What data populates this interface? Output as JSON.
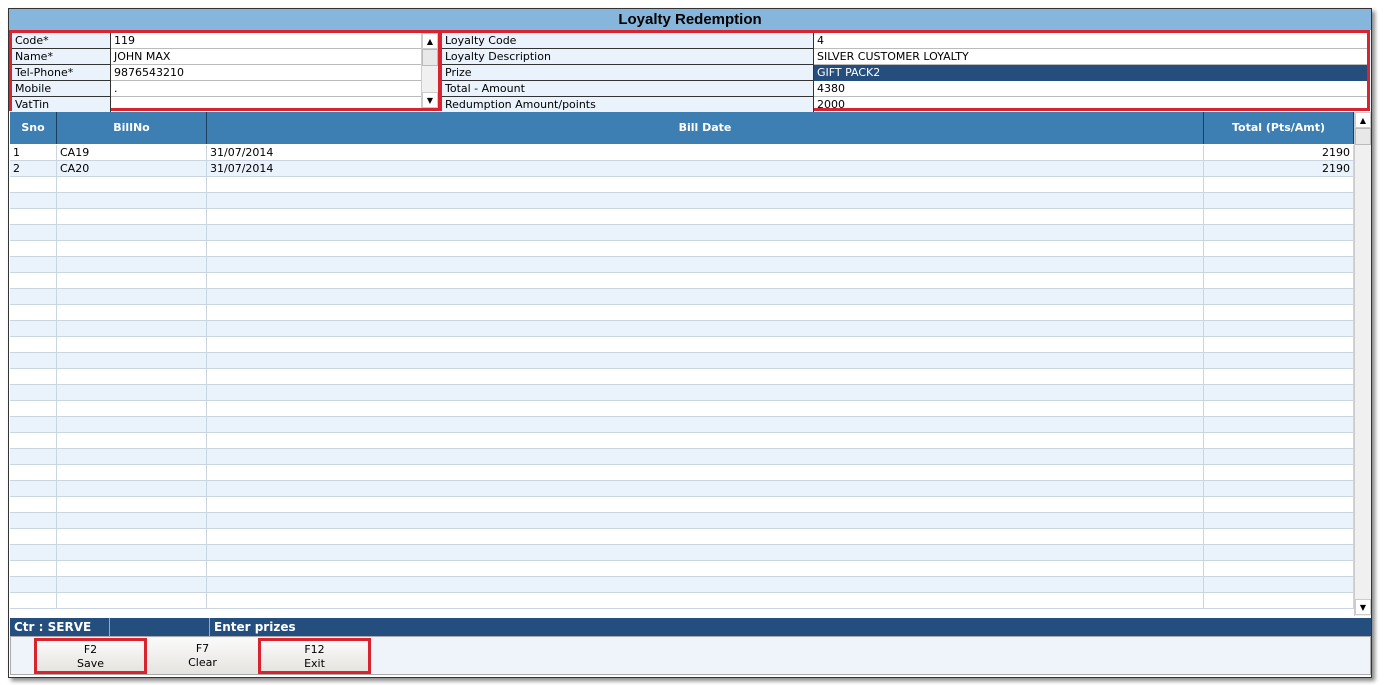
{
  "title": "Loyalty Redemption",
  "customer": [
    {
      "label": "Code*",
      "value": "119"
    },
    {
      "label": "Name*",
      "value": "JOHN MAX"
    },
    {
      "label": "Tel-Phone*",
      "value": "9876543210"
    },
    {
      "label": "Mobile",
      "value": "."
    },
    {
      "label": "VatTin",
      "value": ""
    }
  ],
  "loyalty": [
    {
      "label": "Loyalty Code",
      "value": "4"
    },
    {
      "label": "Loyalty Description",
      "value": "SILVER CUSTOMER LOYALTY"
    },
    {
      "label": "Prize",
      "value": "GIFT PACK2"
    },
    {
      "label": "Total - Amount",
      "value": "4380"
    },
    {
      "label": "Redumption Amount/points",
      "value": "2000"
    }
  ],
  "grid": {
    "headers": [
      "Sno",
      "BillNo",
      "Bill Date",
      "Total (Pts/Amt)"
    ],
    "rows": [
      [
        "1",
        "CA19",
        "31/07/2014",
        "2190"
      ],
      [
        "2",
        "CA20",
        "31/07/2014",
        "2190"
      ]
    ]
  },
  "status": {
    "counter": "Ctr : SERVE",
    "middle": "",
    "message": "Enter prizes"
  },
  "buttons": [
    {
      "key": "F2",
      "label": "Save"
    },
    {
      "key": "F7",
      "label": "Clear"
    },
    {
      "key": "F12",
      "label": "Exit"
    }
  ],
  "icons": {
    "up": "scroll-up-arrow",
    "down": "scroll-down-arrow"
  }
}
